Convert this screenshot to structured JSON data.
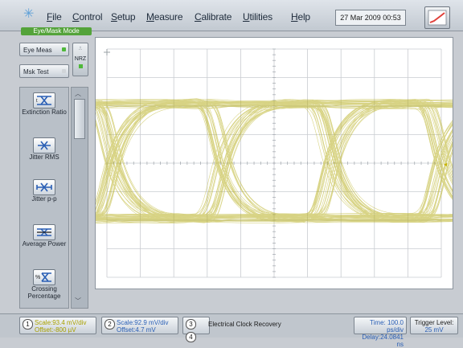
{
  "menubar": {
    "logo_icon": "starburst-icon",
    "items": [
      {
        "ul": "F",
        "rest": "ile"
      },
      {
        "ul": "C",
        "rest": "ontrol"
      },
      {
        "ul": "S",
        "rest": "etup"
      },
      {
        "ul": "M",
        "rest": "easure"
      },
      {
        "ul": "C",
        "rest": "alibrate"
      },
      {
        "ul": "U",
        "rest": "tilities"
      },
      {
        "ul": "H",
        "rest": "elp"
      }
    ],
    "datetime": "27 Mar 2009  00:53",
    "corner_icon": "waveform-icon"
  },
  "mode_label": "Eye/Mask Mode",
  "left": {
    "eye_meas": "Eye Meas",
    "msk_test": "Msk Test",
    "nrz": "NRZ",
    "tools": [
      {
        "label": "Extinction Ratio",
        "icon": "extinction-ratio-icon"
      },
      {
        "label": "Jitter RMS",
        "icon": "jitter-rms-icon"
      },
      {
        "label": "Jitter p-p",
        "icon": "jitter-pp-icon"
      },
      {
        "label": "Average Power",
        "icon": "average-power-icon"
      },
      {
        "label": "Crossing Percentage",
        "icon": "crossing-percentage-icon"
      }
    ]
  },
  "status": {
    "ch1": {
      "num": "1",
      "scale": "Scale:93.4 mV/div",
      "offset": "Offset:-800 µV"
    },
    "ch2": {
      "num": "2",
      "scale": "Scale:92.9 mV/div",
      "offset": "Offset:4.7 mV"
    },
    "ch3": "3",
    "ch4": "4",
    "clock": "Electrical Clock Recovery",
    "time": "Time: 100.0 ps/div",
    "delay": "Delay:24.0841 ns",
    "trigger_label": "Trigger Level:",
    "trigger_value": "25 mV"
  },
  "colors": {
    "trace": "#b8b020",
    "accent_green": "#54a33a"
  }
}
